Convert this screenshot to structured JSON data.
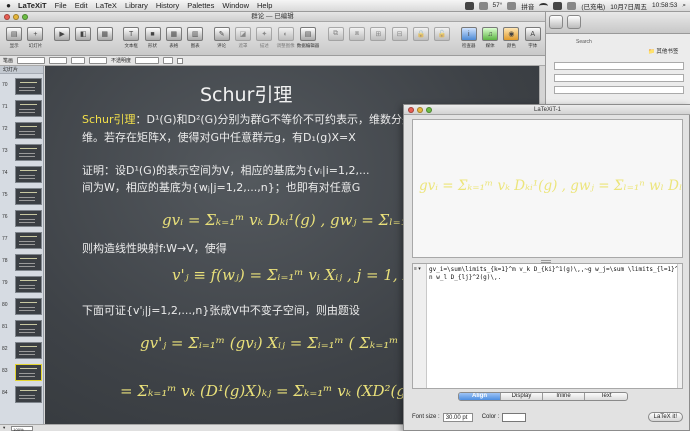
{
  "menubar": {
    "app_name": "LaTeXiT",
    "items": [
      "File",
      "Edit",
      "LaTeX",
      "Library",
      "History",
      "Palettes",
      "Window",
      "Help"
    ],
    "temperature": "57°",
    "input_method": "拼音",
    "battery": "(已充电)",
    "date": "10月7日周五",
    "time": "10:58:53"
  },
  "presentation": {
    "window_title": "群论 — 已编辑",
    "toolbar": [
      "显示",
      "幻灯片",
      "",
      "",
      "",
      "",
      "文本框",
      "形状",
      "表格",
      "图表",
      "",
      "评论",
      "遮罩",
      "描述",
      "调整图像",
      "数据编辑器",
      "",
      "",
      "",
      "",
      "",
      "",
      "",
      "",
      "检查器",
      "媒体",
      "颜色",
      "字体"
    ],
    "formatbar": {
      "label": "笔画",
      "label2": "不透明度"
    },
    "nav_title": "幻灯片",
    "slide_numbers": [
      "70",
      "71",
      "72",
      "73",
      "74",
      "75",
      "76",
      "77",
      "78",
      "79",
      "80",
      "81",
      "82",
      "83",
      "84"
    ],
    "zoom": "100%",
    "slide": {
      "title": "Schur引理",
      "line1_hl": "Schur引理",
      "line1": "：D¹(G)和D²(G)分别为群G不等价不可约表示，维数分别为m维和n",
      "line2": "维。若存在矩阵X，使得对G中任意群元g，有D₁(g)X=X",
      "line3": "证明：设D¹(G)的表示空间为V，相应的基底为{vᵢ|i=1,2,...",
      "line4": "间为W，相应的基底为{wⱼ|j=1,2,...,n}；也即有对任意G",
      "line5": "则构造线性映射f:W→V，使得",
      "line6": "下面可证{v'ⱼ|j=1,2,...,n}张成V中不变子空间，则由题设",
      "eq1": "gvᵢ = Σₖ₌₁ᵐ vₖ Dₖᵢ¹(g) ,   gwⱼ = Σₗ₌₁ⁿ wₗ D",
      "eq2": "v'ⱼ ≡ f(wⱼ) = Σᵢ₌₁ᵐ vᵢ Xᵢⱼ ,   j = 1, 2, .",
      "eq3": "gv'ⱼ = Σᵢ₌₁ᵐ (gvᵢ) Xᵢⱼ = Σᵢ₌₁ᵐ ( Σₖ₌₁ᵐ vₖ Dₖᵢ¹(g) )",
      "eq4": "=  Σₖ₌₁ᵐ vₖ (D¹(g)X)ₖⱼ = Σₖ₌₁ᵐ vₖ (XD²(g))ₖⱼ"
    }
  },
  "latexit": {
    "window_title": "LaTeXiT-1",
    "preview_eq": "gvᵢ = Σₖ₌₁ᵐ vₖ Dₖᵢ¹(g) ,   gwⱼ = Σₗ₌₁ⁿ wₗ Dₗⱼ²(g) ,",
    "gutter_label": "≡ ▾",
    "source_line1": "gv_i=\\sum\\limits_{k=1}^m v_k D_{ki}^1(g)\\,,~g w_j=\\sum",
    "source_line2": "\\limits_{l=1}^n w_l D_{lj}^2(g)\\,.",
    "modes": [
      "Align",
      "Display",
      "Inline",
      "Text"
    ],
    "active_mode": "Align",
    "font_size_label": "Font size :",
    "font_size_value": "30.00 pt",
    "color_label": "Color :",
    "color_value": "#f5ee3b",
    "latex_button": "LaTeX it!"
  },
  "bg_browser": {
    "search_label": "Search",
    "side_text": "📁 其他书签"
  }
}
